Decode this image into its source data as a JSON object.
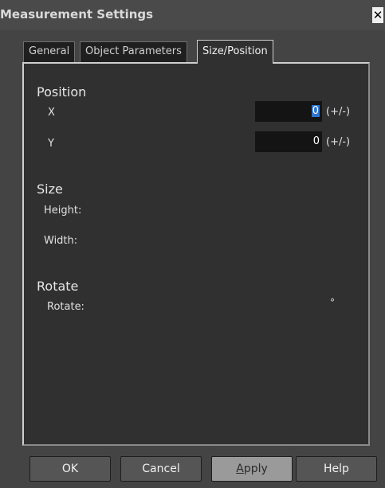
{
  "window": {
    "title": "Measurement Settings",
    "close_symbol": "✕"
  },
  "tabs": [
    {
      "label": "General",
      "active": false
    },
    {
      "label": "Object Parameters",
      "active": false
    },
    {
      "label": "Size/Position",
      "active": true
    }
  ],
  "position": {
    "heading": "Position",
    "x": {
      "label": "X",
      "value": "0",
      "unit": "(+/-)"
    },
    "y": {
      "label": "Y",
      "value": "0",
      "unit": "(+/-)"
    }
  },
  "size": {
    "heading": "Size",
    "height_label": "Height:",
    "width_label": "Width:"
  },
  "rotate": {
    "heading": "Rotate",
    "label": "Rotate:",
    "unit": "°"
  },
  "buttons": {
    "ok": "OK",
    "cancel": "Cancel",
    "apply_mnemonic": "A",
    "apply_rest": "pply",
    "help": "Help"
  }
}
